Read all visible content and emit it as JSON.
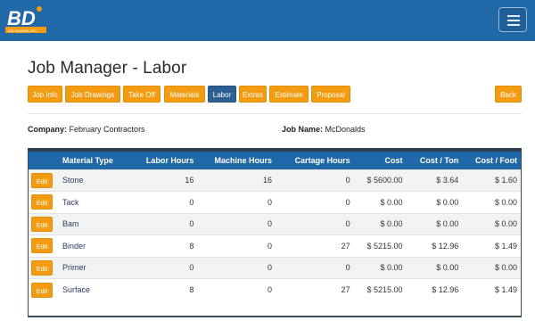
{
  "header": {
    "logo_text": "BD",
    "logo_subtext": "BID MANUAL INC.",
    "menu_icon": "hamburger-icon"
  },
  "page": {
    "title": "Job Manager - Labor"
  },
  "tabs": [
    {
      "label": "Job Info",
      "active": false
    },
    {
      "label": "Job Drawings",
      "active": false
    },
    {
      "label": "Take Off",
      "active": false
    },
    {
      "label": "Materials",
      "active": false
    },
    {
      "label": "Labor",
      "active": true
    },
    {
      "label": "Extras",
      "active": false
    },
    {
      "label": "Estimate",
      "active": false
    },
    {
      "label": "Proposal",
      "active": false
    }
  ],
  "back_label": "Back",
  "job": {
    "company_label": "Company:",
    "company_value": "February Contractors",
    "jobname_label": "Job Name:",
    "jobname_value": "McDonalds"
  },
  "table": {
    "columns": [
      "Material Type",
      "Labor Hours",
      "Machine Hours",
      "Cartage Hours",
      "Cost",
      "Cost / Ton",
      "Cost / Foot"
    ],
    "edit_label": "Edit",
    "rows": [
      [
        "Stone",
        "16",
        "16",
        "0",
        "$ 5600.00",
        "$ 3.64",
        "$ 1.60"
      ],
      [
        "Tack",
        "0",
        "0",
        "0",
        "$ 0.00",
        "$ 0.00",
        "$ 0.00"
      ],
      [
        "Bam",
        "0",
        "0",
        "0",
        "$ 0.00",
        "$ 0.00",
        "$ 0.00"
      ],
      [
        "Binder",
        "8",
        "0",
        "27",
        "$ 5215.00",
        "$ 12.96",
        "$ 1.49"
      ],
      [
        "Primer",
        "0",
        "0",
        "0",
        "$ 0.00",
        "$ 0.00",
        "$ 0.00"
      ],
      [
        "Surface",
        "8",
        "0",
        "27",
        "$ 5215.00",
        "$ 12.96",
        "$ 1.49"
      ]
    ]
  },
  "colors": {
    "nav": "#2068a8",
    "accent": "#f39c12",
    "active_tab": "#2f5f92"
  }
}
